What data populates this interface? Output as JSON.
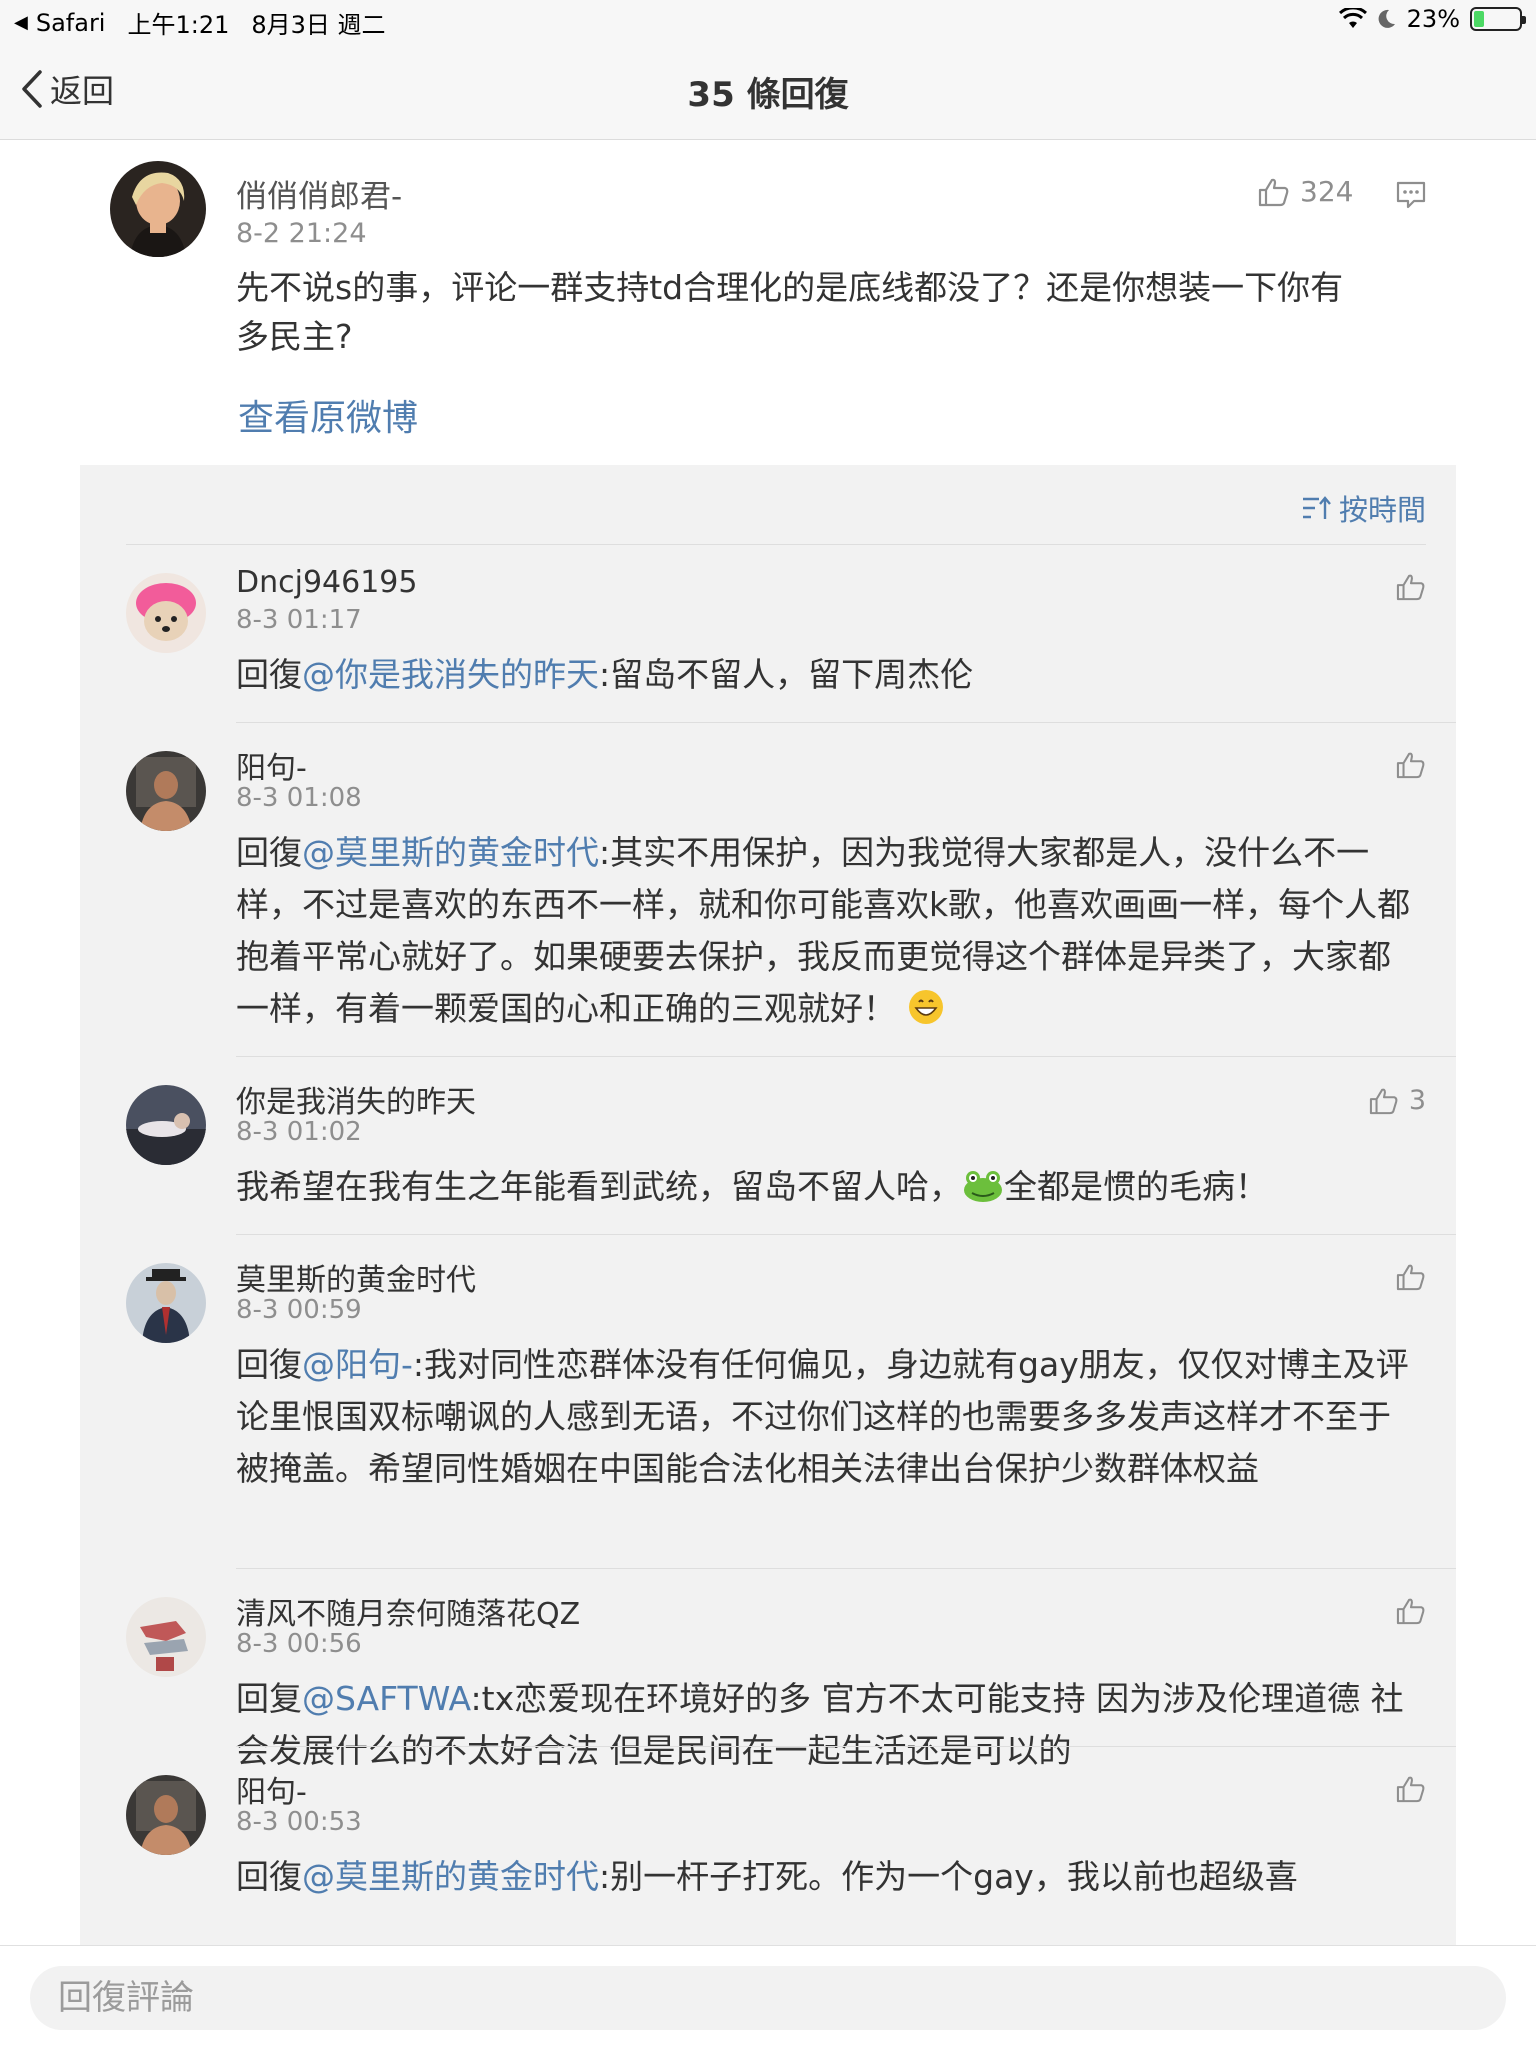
{
  "status_bar": {
    "app": "Safari",
    "time": "上午1:21",
    "date": "8月3日 週二",
    "battery": "23%",
    "battery_level": 0.23
  },
  "nav": {
    "back_label": "返回",
    "title": "35 條回復"
  },
  "post": {
    "author": "俏俏俏郎君-",
    "time": "8-2 21:24",
    "likes": "324",
    "text": "先不说s的事，评论一群支持td合理化的是底线都没了？还是你想装一下你有多民主?",
    "view_original": "查看原微博"
  },
  "sort": {
    "label": "按時間"
  },
  "replies": [
    {
      "name": "Dncj946195",
      "time": "8-3 01:17",
      "likes": "",
      "prefix": "回復",
      "mention": "@你是我消失的昨天",
      "text": ":留岛不留人，留下周杰伦"
    },
    {
      "name": "阳句-",
      "time": "8-3 01:08",
      "likes": "",
      "prefix": "回復",
      "mention": "@莫里斯的黄金时代",
      "text": ":其实不用保护，因为我觉得大家都是人，没什么不一样，不过是喜欢的东西不一样，就和你可能喜欢k歌，他喜欢画画一样，每个人都抱着平常心就好了。如果硬要去保护，我反而更觉得这个群体是异类了，大家都一样，有着一颗爱国的心和正确的三观就好！",
      "emoji": "grinning-face"
    },
    {
      "name": "你是我消失的昨天",
      "time": "8-3 01:02",
      "likes": "3",
      "prefix": "",
      "mention": "",
      "text_before": "我希望在我有生之年能看到武统，留岛不留人哈，",
      "emoji": "frog-face",
      "text": "全都是惯的毛病！"
    },
    {
      "name": "莫里斯的黄金时代",
      "time": "8-3 00:59",
      "likes": "",
      "prefix": "回復",
      "mention": "@阳句-",
      "text": ":我对同性恋群体没有任何偏见，身边就有gay朋友，仅仅对博主及评论里恨国双标嘲讽的人感到无语，不过你们这样的也需要多多发声这样才不至于被掩盖。希望同性婚姻在中国能合法化相关法律出台保护少数群体权益"
    },
    {
      "name": "清风不随月奈何随落花QZ",
      "time": "8-3 00:56",
      "likes": "",
      "prefix": "回复",
      "mention": "@SAFTWA",
      "text": ":tx恋爱现在环境好的多 官方不太可能支持 因为涉及伦理道德 社会发展什么的不太好合法 但是民间在一起生活还是可以的"
    },
    {
      "name": "阳句-",
      "time": "8-3 00:53",
      "likes": "",
      "prefix": "回復",
      "mention": "@莫里斯的黄金时代",
      "text": ":别一杆子打死。作为一个gay，我以前也超级喜"
    }
  ],
  "bottom": {
    "placeholder": "回復評論"
  },
  "colors": {
    "link": "#507daf",
    "panel_bg": "#f2f2f2",
    "text": "#333333",
    "meta": "#8e8e8e"
  }
}
